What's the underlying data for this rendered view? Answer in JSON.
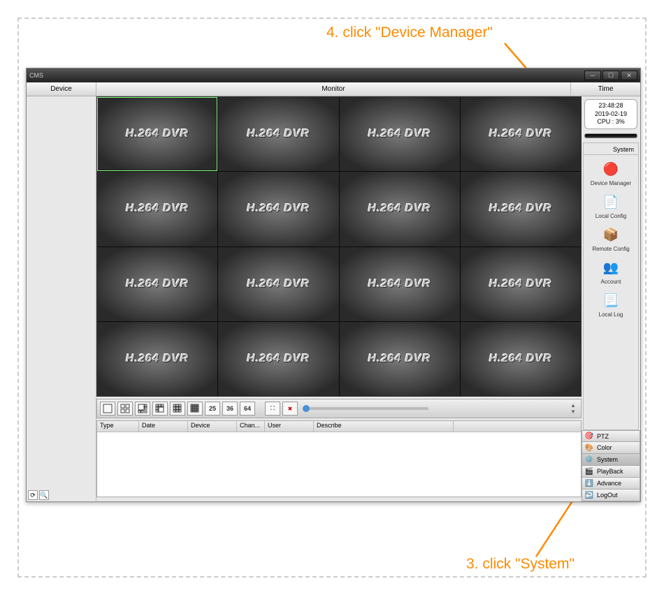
{
  "annotations": {
    "step4": "4. click \"Device Manager\"",
    "step3": "3. click \"System\""
  },
  "titlebar": {
    "title": "CMS"
  },
  "tabs": {
    "device": "Device",
    "monitor": "Monitor",
    "time": "Time"
  },
  "cell_label": "H.264 DVR",
  "clock": {
    "time": "23:48:28",
    "date": "2019-02-19",
    "cpu": "CPU : 3%"
  },
  "system_panel": {
    "title": "System",
    "items": [
      {
        "label": "Device Manager",
        "icon": "🔴"
      },
      {
        "label": "Local Config",
        "icon": "📄"
      },
      {
        "label": "Remote Config",
        "icon": "📦"
      },
      {
        "label": "Account",
        "icon": "👥"
      },
      {
        "label": "Local Log",
        "icon": "📃"
      }
    ]
  },
  "menu": [
    {
      "label": "PTZ",
      "icon": "🎯"
    },
    {
      "label": "Color",
      "icon": "🎨"
    },
    {
      "label": "System",
      "icon": "⚙️",
      "active": true
    },
    {
      "label": "PlayBack",
      "icon": "🎬"
    },
    {
      "label": "Advance",
      "icon": "⬇️"
    },
    {
      "label": "LogOut",
      "icon": "↩️"
    }
  ],
  "toolbar_numbers": [
    "25",
    "36",
    "64"
  ],
  "log_columns": [
    "Type",
    "Date",
    "Device",
    "Chan...",
    "User",
    "Describe"
  ],
  "log_col_widths": [
    60,
    70,
    70,
    40,
    70,
    200
  ]
}
